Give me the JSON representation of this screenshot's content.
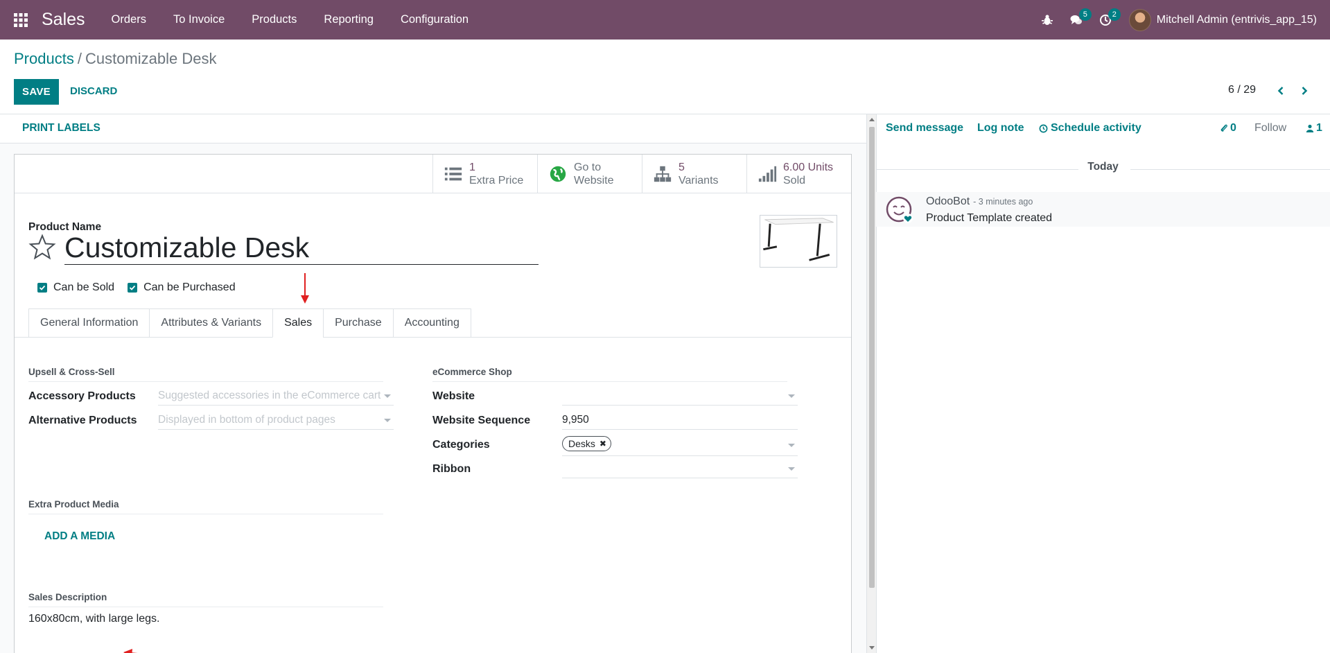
{
  "topbar": {
    "app_name": "Sales",
    "menu": [
      "Orders",
      "To Invoice",
      "Products",
      "Reporting",
      "Configuration"
    ],
    "messages_badge": "5",
    "activities_badge": "2",
    "user_name": "Mitchell Admin (entrivis_app_15)",
    "color": "#714b67"
  },
  "breadcrumb": {
    "parent": "Products",
    "separator": "/",
    "current": "Customizable Desk"
  },
  "toolbar": {
    "save_label": "SAVE",
    "discard_label": "DISCARD"
  },
  "pager": {
    "value": "6 / 29"
  },
  "statusbar": {
    "print_labels": "PRINT LABELS"
  },
  "smart_buttons": [
    {
      "value": "1",
      "label": "Extra Price",
      "icon": "list-icon"
    },
    {
      "value": "Go to",
      "label": "Website",
      "icon": "globe-icon"
    },
    {
      "value": "5",
      "label": "Variants",
      "icon": "sitemap-icon"
    },
    {
      "value": "6.00 Units",
      "label": "Sold",
      "icon": "signal-icon"
    }
  ],
  "product": {
    "name_label": "Product Name",
    "name": "Customizable Desk",
    "can_be_sold": "Can be Sold",
    "can_be_purchased": "Can be Purchased"
  },
  "tabs": [
    "General Information",
    "Attributes & Variants",
    "Sales",
    "Purchase",
    "Accounting"
  ],
  "active_tab": "Sales",
  "upsell": {
    "title": "Upsell & Cross-Sell",
    "accessory_label": "Accessory Products",
    "accessory_placeholder": "Suggested accessories in the eCommerce cart",
    "alternative_label": "Alternative Products",
    "alternative_placeholder": "Displayed in bottom of product pages"
  },
  "ecommerce": {
    "title": "eCommerce Shop",
    "website_label": "Website",
    "website_value": "",
    "sequence_label": "Website Sequence",
    "sequence_value": "9,950",
    "categories_label": "Categories",
    "category_tag": "Desks",
    "ribbon_label": "Ribbon"
  },
  "media": {
    "title": "Extra Product Media",
    "add_label": "ADD A MEDIA"
  },
  "sales_description": {
    "title": "Sales Description",
    "value": "160x80cm, with large legs."
  },
  "chatter": {
    "send_message": "Send message",
    "log_note": "Log note",
    "schedule_activity": "Schedule activity",
    "attachments_count": "0",
    "follow": "Follow",
    "followers_count": "1",
    "date_separator": "Today",
    "messages": [
      {
        "author": "OdooBot",
        "time": "- 3 minutes ago",
        "body": "Product Template created"
      }
    ]
  },
  "colors": {
    "accent": "#017e84",
    "brand": "#714b67",
    "annotation": "#e02020"
  }
}
